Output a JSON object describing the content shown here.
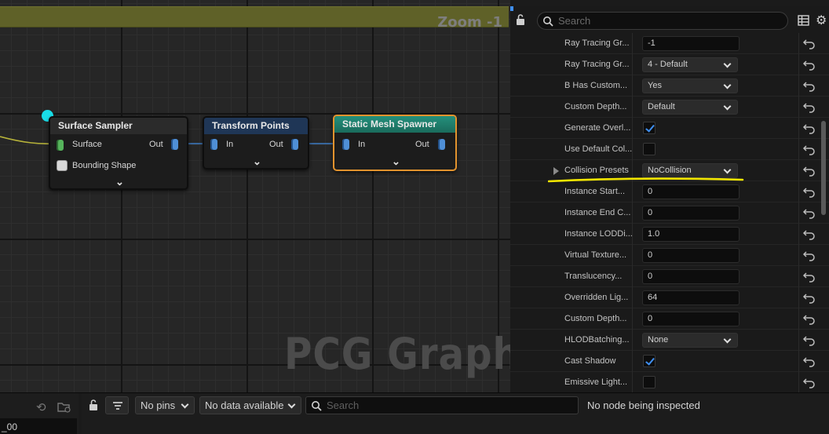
{
  "graph": {
    "zoom_label": "Zoom -1",
    "watermark": "PCG Graph",
    "nodes": [
      {
        "title": "Surface Sampler",
        "pins_in": [
          "Surface",
          "Bounding Shape"
        ],
        "pin_out": "Out"
      },
      {
        "title": "Transform Points",
        "pin_in": "In",
        "pin_out": "Out"
      },
      {
        "title": "Static Mesh Spawner",
        "pin_in": "In",
        "pin_out": "Out"
      }
    ],
    "colors": {
      "surface_sampler_header": "#2b2b2b",
      "transform_points_header": "#1f3656",
      "static_mesh_spawner_header": "#1f7a6a",
      "selection_outline": "#e2932e",
      "wire": "#3d7bc4",
      "input_wire": "#b7b33a"
    }
  },
  "details": {
    "search_placeholder": "Search",
    "properties": [
      {
        "label": "Ray Tracing Gr...",
        "type": "text",
        "value": "-1"
      },
      {
        "label": "Ray Tracing Gr...",
        "type": "dropdown",
        "value": "4 - Default"
      },
      {
        "label": "B Has Custom...",
        "type": "dropdown",
        "value": "Yes"
      },
      {
        "label": "Custom Depth...",
        "type": "dropdown",
        "value": "Default"
      },
      {
        "label": "Generate Overl...",
        "type": "checkbox",
        "checked": true
      },
      {
        "label": "Use Default Col...",
        "type": "checkbox",
        "checked": false
      },
      {
        "label": "Collision Presets",
        "type": "dropdown",
        "value": "NoCollision",
        "expandable": true
      },
      {
        "label": "Instance Start...",
        "type": "text",
        "value": "0"
      },
      {
        "label": "Instance End C...",
        "type": "text",
        "value": "0"
      },
      {
        "label": "Instance LODDi...",
        "type": "text",
        "value": "1.0"
      },
      {
        "label": "Virtual Texture...",
        "type": "text",
        "value": "0"
      },
      {
        "label": "Translucency...",
        "type": "text",
        "value": "0"
      },
      {
        "label": "Overridden Lig...",
        "type": "text",
        "value": "64"
      },
      {
        "label": "Custom Depth...",
        "type": "text",
        "value": "0"
      },
      {
        "label": "HLODBatching...",
        "type": "dropdown",
        "value": "None"
      },
      {
        "label": "Cast Shadow",
        "type": "checkbox",
        "checked": true
      },
      {
        "label": "Emissive Light...",
        "type": "checkbox",
        "checked": false
      }
    ],
    "annotation_color": "#f2e600"
  },
  "bottom": {
    "left_item": "_00",
    "pins_filter": "No pins",
    "data_filter": "No data available",
    "search_placeholder": "Search",
    "status": "No node being inspected"
  }
}
